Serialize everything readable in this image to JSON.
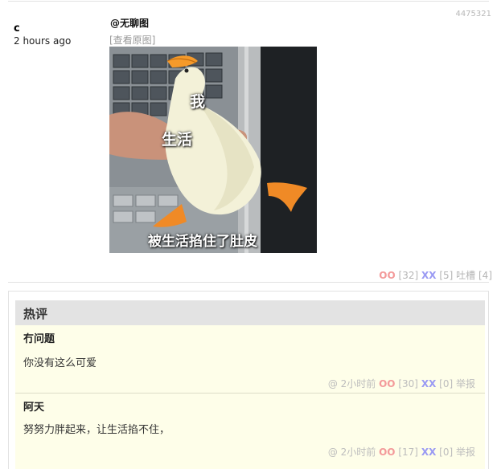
{
  "post": {
    "id": "4475321",
    "author": "c",
    "time": "2 hours ago",
    "caption": "@无聊图",
    "view_original": "[查看原图]",
    "image": {
      "overlay_me": "我",
      "overlay_life": "生活",
      "overlay_bottom": "被生活掐住了肚皮"
    },
    "votes": {
      "oo_label": "OO",
      "oo_count": "[32]",
      "xx_label": "XX",
      "xx_count": "[5]",
      "tucao_label": "吐槽",
      "tucao_count": "[4]"
    }
  },
  "hot": {
    "title": "热评",
    "comments": [
      {
        "author": "冇问题",
        "text": "你没有这么可爱",
        "at": "@",
        "time": "2小时前",
        "oo_label": "OO",
        "oo_count": "[30]",
        "xx_label": "XX",
        "xx_count": "[0]",
        "report": "举报"
      },
      {
        "author": "阿天",
        "text": "努努力胖起来，让生活掐不住，",
        "at": "@",
        "time": "2小时前",
        "oo_label": "OO",
        "oo_count": "[17]",
        "xx_label": "XX",
        "xx_count": "[0]",
        "report": "举报"
      }
    ]
  },
  "colors": {
    "oo": "#f39a9a",
    "xx": "#9a9af3",
    "hot_header_bg": "#e3e3e3",
    "comment_bg": "#fefee9"
  }
}
